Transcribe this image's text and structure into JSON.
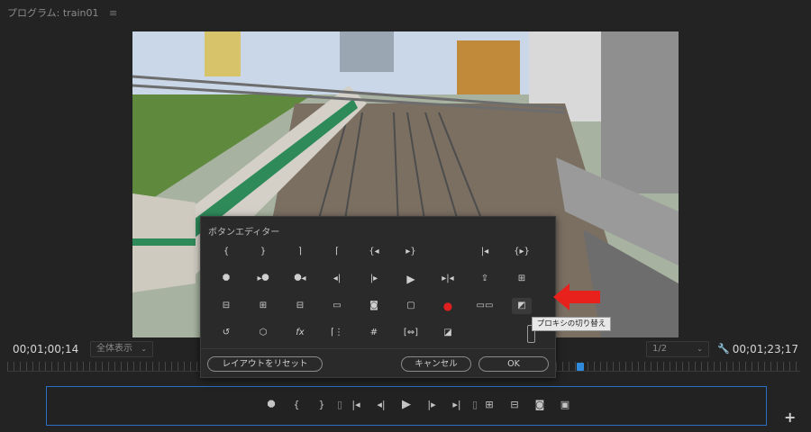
{
  "panel": {
    "title": "プログラム: train01",
    "menu_icon": "hamburger-icon"
  },
  "timecodes": {
    "left": "00;01;00;14",
    "right": "00;01;23;17"
  },
  "fit": {
    "value": "全体表示"
  },
  "resolution": {
    "value": "1/2"
  },
  "dialog": {
    "title": "ボタンエディター",
    "reset_label": "レイアウトをリセット",
    "cancel_label": "キャンセル",
    "ok_label": "OK",
    "tooltip": "プロキシの切り替え"
  },
  "editor_buttons": [
    [
      "mark-in-icon",
      "mark-out-icon",
      "mark-clip-icon",
      "go-to-in-icon",
      "go-to-in-point-icon",
      "go-to-out-point-icon",
      "go-to-prev-edit-icon",
      "play-in-to-out-icon"
    ],
    [
      "add-marker-icon",
      "go-to-next-marker-icon",
      "go-to-prev-marker-icon",
      "step-back-icon",
      "step-forward-icon",
      "play-icon",
      "go-to-next-edit-icon",
      "export-icon",
      "lift-icon"
    ],
    [
      "extract-icon",
      "insert-icon",
      "overwrite-icon",
      "safe-margins-icon",
      "camera-icon",
      "comment-icon",
      "record-icon",
      "multicam-icon",
      "toggle-proxies-icon"
    ],
    [
      "loop-icon",
      "vr-icon",
      "fx-icon",
      "transmit-icon",
      "grid-icon",
      "shuttle-icon",
      "compare-icon"
    ]
  ],
  "accent_color": "#2a6fc2",
  "record_color": "#e02020",
  "arrow_color": "#e8211c"
}
